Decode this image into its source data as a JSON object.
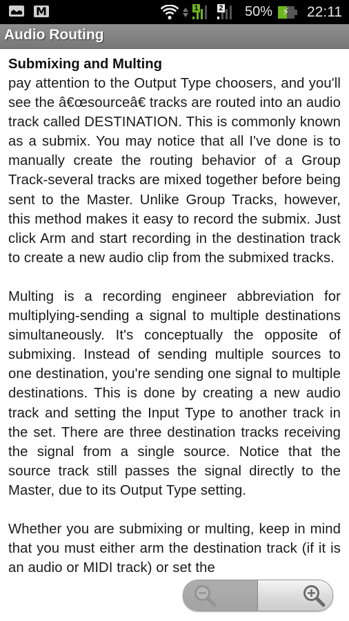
{
  "status_bar": {
    "left_icons": [
      "gallery-icon",
      "gmail-icon"
    ],
    "right_icons": [
      "wifi-icon",
      "data-activity-icon",
      "signal-sim1-icon",
      "signal-sim2-icon",
      "battery-charging-icon"
    ],
    "sim1_label": "1",
    "sim2_label": "2",
    "battery_percent": "50%",
    "battery_level": 0.5,
    "time": "22:11",
    "colors": {
      "sim1_accent": "#6fb520",
      "battery_fill": "#6fb520"
    }
  },
  "title_bar": {
    "title": "Audio Routing"
  },
  "article": {
    "heading": "Submixing and Multing",
    "paragraphs": [
      "pay attention to the Output Type choosers, and you'll see the â€œsourceâ€ tracks are routed into an audio track called DESTINATION. This is commonly known as a submix. You may notice that all I've done is to manually create the routing behavior of a Group Track-several tracks are mixed together before being sent to the Master. Unlike Group Tracks, however, this method makes it easy to record the submix. Just click Arm and start recording in the destination track to create a new audio clip from the submixed tracks.",
      "Multing is a recording engineer abbreviation for multiplying-sending a signal to multiple destinations simultaneously. It's conceptually the opposite of submixing. Instead of sending multiple sources to one destination, you're sending one signal to multiple destinations. This is done by creating a new audio track and setting the Input Type to another track in the set. There are three destination tracks receiving the signal from a single source. Notice that the source track still passes the signal directly to the Master, due to its Output Type setting.",
      "Whether you are submixing or multing, keep in mind that you must either arm the destination track (if it is an audio or MIDI track) or set the"
    ]
  },
  "zoom_controls": {
    "zoom_out_icon": "zoom-out-icon",
    "zoom_in_icon": "zoom-in-icon"
  }
}
